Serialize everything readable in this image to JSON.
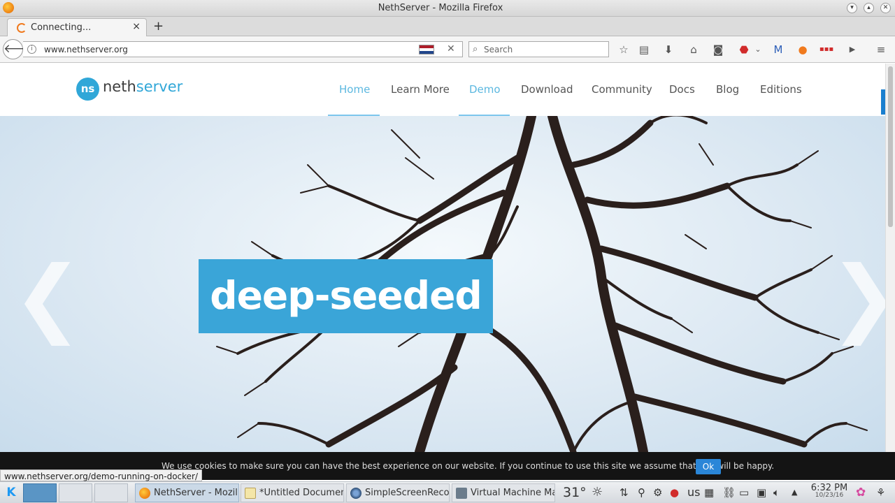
{
  "window": {
    "title": "NethServer - Mozilla Firefox",
    "app_icon": "firefox-icon",
    "controls": [
      "minimize",
      "maximize",
      "close"
    ]
  },
  "tabs": [
    {
      "label": "Connecting...",
      "loading": true,
      "close": "×"
    }
  ],
  "new_tab": "+",
  "nav": {
    "url": "www.nethserver.org",
    "search_placeholder": "Search",
    "back_icon": "back-arrow-icon",
    "flag": "netherlands"
  },
  "site": {
    "logo_glyph": "ns",
    "logo_text_a": "neth",
    "logo_text_b": "server",
    "menu": [
      {
        "label": "Home",
        "active": true
      },
      {
        "label": "Learn More",
        "active": false
      },
      {
        "label": "Demo",
        "active": true
      },
      {
        "label": "Download",
        "active": false
      },
      {
        "label": "Community",
        "active": false
      },
      {
        "label": "Docs",
        "active": false
      },
      {
        "label": "Blog",
        "active": false
      },
      {
        "label": "Editions",
        "active": false
      }
    ],
    "hero_text": "deep-seeded",
    "prev": "❮",
    "next": "❯"
  },
  "cookie": {
    "message": "We use cookies to make sure you can have the best experience on our website. If you continue to use this site we assume that you will be happy.",
    "ok": "Ok"
  },
  "status_url": "www.nethserver.org/demo-running-on-docker/",
  "taskbar": {
    "tasks": [
      {
        "label": "NethServer - Mozil",
        "icon": "firefox-icon",
        "active": true
      },
      {
        "label": "*Untitled Documen",
        "icon": "text-editor-icon",
        "active": false
      },
      {
        "label": "SimpleScreenReco",
        "icon": "screen-recorder-icon",
        "active": false
      },
      {
        "label": "Virtual Machine Ma",
        "icon": "virt-manager-icon",
        "active": false
      }
    ],
    "weather": "31°",
    "keyboard": "us",
    "time": "6:32 PM",
    "date": "10/23/16"
  },
  "colors": {
    "accent": "#30a7d8",
    "banner": "#3aa5d8",
    "nav_active": "#5cb8e0",
    "cookie_bg": "#141414",
    "ok_button": "#2a86d8"
  }
}
